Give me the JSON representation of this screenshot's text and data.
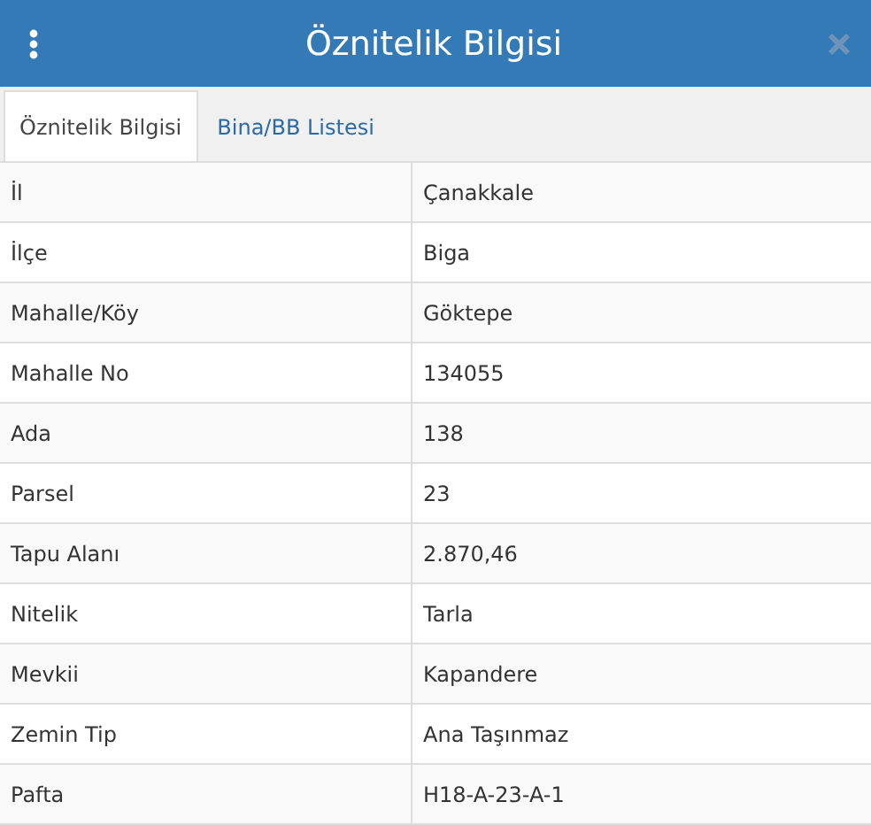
{
  "header": {
    "title": "Öznitelik Bilgisi"
  },
  "tabs": [
    {
      "label": "Öznitelik Bilgisi",
      "selected": true
    },
    {
      "label": "Bina/BB Listesi",
      "selected": false
    }
  ],
  "table": {
    "rows": [
      {
        "label": "İl",
        "value": "Çanakkale"
      },
      {
        "label": "İlçe",
        "value": "Biga"
      },
      {
        "label": "Mahalle/Köy",
        "value": "Göktepe"
      },
      {
        "label": "Mahalle No",
        "value": "134055"
      },
      {
        "label": "Ada",
        "value": "138"
      },
      {
        "label": "Parsel",
        "value": "23"
      },
      {
        "label": "Tapu Alanı",
        "value": "2.870,46"
      },
      {
        "label": "Nitelik",
        "value": "Tarla"
      },
      {
        "label": "Mevkii",
        "value": "Kapandere"
      },
      {
        "label": "Zemin Tip",
        "value": "Ana Taşınmaz"
      },
      {
        "label": "Pafta",
        "value": "H18-A-23-A-1"
      }
    ]
  }
}
